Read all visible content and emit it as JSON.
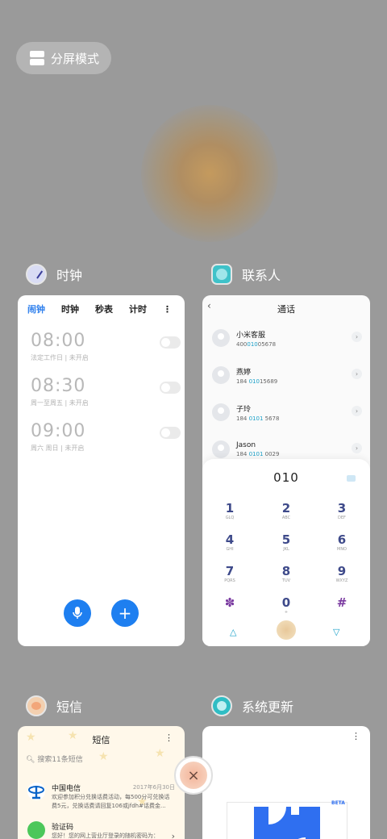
{
  "split_mode": {
    "label": "分屏模式"
  },
  "apps": {
    "clock": {
      "title": "时钟",
      "tabs": [
        "闹钟",
        "时钟",
        "秒表",
        "计时"
      ],
      "more": "⋮",
      "alarms": [
        {
          "time": "08:00",
          "detail": "法定工作日 | 未开启",
          "enabled": false
        },
        {
          "time": "08:30",
          "detail": "周一至周五 | 未开启",
          "enabled": false
        },
        {
          "time": "09:00",
          "detail": "周六 周日 | 未开启",
          "enabled": false
        }
      ],
      "mic_icon": "microphone-icon",
      "add_icon": "+"
    },
    "contacts": {
      "title": "联系人",
      "header": "通话",
      "back": "‹",
      "list": [
        {
          "name": "小米客服",
          "num_pre": "400",
          "num_hl": "010",
          "num_post": "05678"
        },
        {
          "name": "燕婷",
          "num_pre": "184 ",
          "num_hl": "010",
          "num_post": "15689"
        },
        {
          "name": "子玲",
          "num_pre": "184 ",
          "num_hl": "0101",
          "num_post": " 5678"
        },
        {
          "name": "Jason",
          "num_pre": "184 ",
          "num_hl": "0101",
          "num_post": " 0029"
        }
      ],
      "dial_input": "010",
      "keys": [
        {
          "d": "1",
          "l": "GLQ"
        },
        {
          "d": "2",
          "l": "ABC"
        },
        {
          "d": "3",
          "l": "DEF"
        },
        {
          "d": "4",
          "l": "GHI"
        },
        {
          "d": "5",
          "l": "JKL"
        },
        {
          "d": "6",
          "l": "MNO"
        },
        {
          "d": "7",
          "l": "PQRS"
        },
        {
          "d": "8",
          "l": "TUV"
        },
        {
          "d": "9",
          "l": "WXYZ"
        },
        {
          "d": "✽",
          "l": ""
        },
        {
          "d": "0",
          "l": "+"
        },
        {
          "d": "#",
          "l": ""
        }
      ]
    },
    "sms": {
      "title": "短信",
      "header": "短信",
      "search_placeholder": "搜索11条短信",
      "items": [
        {
          "from": "中国电信",
          "date": "2017年6月30日",
          "body": "欢迎参加积分兑换话费活动，每500分可兑换话费5元，兑换话费请回复106或jfdh#话费金..."
        },
        {
          "from": "验证码",
          "date": "",
          "body": "您好！您的网上营业厅登录的随机密码为："
        }
      ]
    },
    "update": {
      "title": "系统更新",
      "beta": "BETA"
    }
  },
  "close_all": {
    "icon": "×"
  },
  "colors": {
    "accent": "#1e7ff0",
    "highlight": "#1aa0c8",
    "backdrop": "#9a9a9a"
  }
}
